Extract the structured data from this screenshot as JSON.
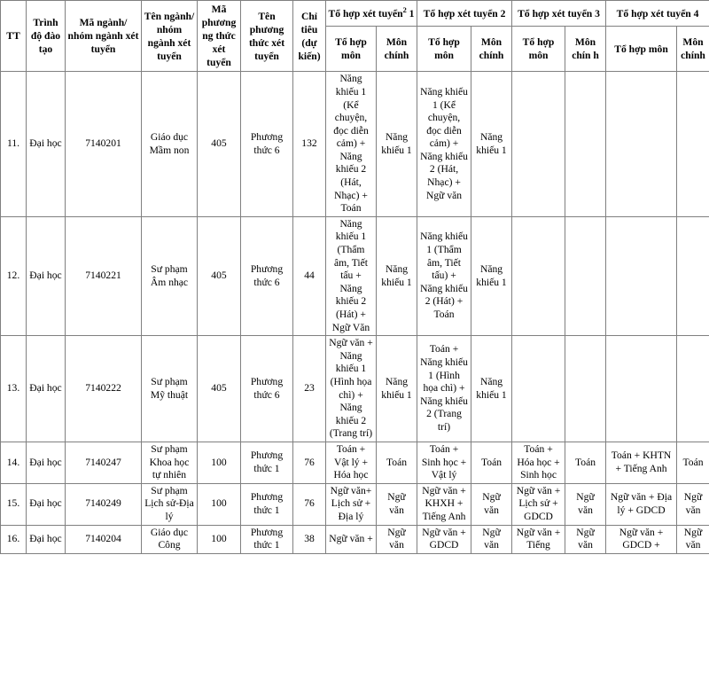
{
  "table": {
    "header": {
      "row1": [
        {
          "label": "TT",
          "rowspan": 2,
          "colspan": 1
        },
        {
          "label": "Trình độ đào tạo",
          "rowspan": 2,
          "colspan": 1
        },
        {
          "label": "Mã ngành/ nhóm ngành xét tuyển",
          "rowspan": 2,
          "colspan": 1
        },
        {
          "label": "Tên ngành/ nhóm ngành xét tuyển",
          "rowspan": 2,
          "colspan": 1
        },
        {
          "label": "Mã phương ng thức xét tuyển",
          "rowspan": 2,
          "colspan": 1
        },
        {
          "label": "Tên phương thức xét tuyển",
          "rowspan": 2,
          "colspan": 1
        },
        {
          "label": "Chỉ tiêu (dự kiến)",
          "rowspan": 2,
          "colspan": 1
        },
        {
          "label": "Tổ hợp xét tuyển",
          "footnote": "2",
          "suffix": " 1",
          "rowspan": 1,
          "colspan": 2
        },
        {
          "label": "Tổ hợp xét tuyển 2",
          "rowspan": 1,
          "colspan": 2
        },
        {
          "label": "Tổ hợp xét tuyển 3",
          "rowspan": 1,
          "colspan": 2
        },
        {
          "label": "Tổ hợp xét tuyển 4",
          "rowspan": 1,
          "colspan": 2
        }
      ],
      "row2": [
        "Tổ hợp môn",
        "Môn chính",
        "Tổ hợp môn",
        "Môn chính",
        "Tổ hợp môn",
        "Môn chín h",
        "Tổ hợp môn",
        "Môn chính"
      ]
    },
    "rows": [
      {
        "tt": "11.",
        "trinh_do": "Đại học",
        "ma_nganh": "7140201",
        "ten_nganh": "Giáo dục Mầm non",
        "ma_phuong_thuc": "405",
        "ten_phuong_thuc": "Phương thức 6",
        "ten_phuong_thuc_align": "middle",
        "chi_tieu": "132",
        "to_hop_1": "Năng khiếu 1 (Kể chuyện, đọc diễn cảm) + Năng khiếu 2 (Hát, Nhạc) + Toán",
        "mon_chinh_1": "Năng khiếu 1",
        "to_hop_2": "Năng khiếu 1 (Kể chuyện, đọc diễn cảm) + Năng khiếu 2 (Hát, Nhạc) + Ngữ văn",
        "mon_chinh_2": "Năng khiếu 1",
        "to_hop_3": "",
        "mon_chinh_3": "",
        "to_hop_4": "",
        "mon_chinh_4": ""
      },
      {
        "tt": "12.",
        "trinh_do": "Đại học",
        "ma_nganh": "7140221",
        "ten_nganh": "Sư phạm Âm nhạc",
        "ma_phuong_thuc": "405",
        "ten_phuong_thuc": "Phương thức 6",
        "ten_phuong_thuc_align": "top",
        "chi_tieu": "44",
        "to_hop_1": "Năng khiếu 1 (Thẩm âm, Tiết tấu + Năng khiếu 2 (Hát) + Ngữ Văn",
        "mon_chinh_1": "Năng khiếu 1",
        "to_hop_2": "Năng khiếu 1 (Thẩm âm, Tiết tấu) + Năng khiếu 2 (Hát) + Toán",
        "mon_chinh_2": "Năng khiếu 1",
        "to_hop_3": "",
        "mon_chinh_3": "",
        "to_hop_4": "",
        "mon_chinh_4": ""
      },
      {
        "tt": "13.",
        "trinh_do": "Đại học",
        "ma_nganh": "7140222",
        "ten_nganh": "Sư phạm Mỹ thuật",
        "ma_phuong_thuc": "405",
        "ten_phuong_thuc": "Phương thức 6",
        "ten_phuong_thuc_align": "top",
        "chi_tieu": "23",
        "to_hop_1": "Ngữ văn + Năng khiếu 1 (Hình họa chì) + Năng khiếu 2 (Trang trí)",
        "mon_chinh_1": "Năng khiếu 1",
        "to_hop_2": "Toán + Năng khiếu 1 (Hình họa chì) + Năng khiếu 2 (Trang trí)",
        "mon_chinh_2": "Năng khiếu 1",
        "to_hop_3": "",
        "mon_chinh_3": "",
        "to_hop_4": "",
        "mon_chinh_4": ""
      },
      {
        "tt": "14.",
        "trinh_do": "Đại học",
        "ma_nganh": "7140247",
        "ten_nganh": "Sư phạm Khoa học tự nhiên",
        "ma_phuong_thuc": "100",
        "ten_phuong_thuc": "Phương thức 1",
        "ten_phuong_thuc_align": "middle",
        "chi_tieu": "76",
        "to_hop_1": "Toán + Vật lý + Hóa học",
        "mon_chinh_1": "Toán",
        "to_hop_2": "Toán + Sinh học + Vật lý",
        "mon_chinh_2": "Toán",
        "to_hop_3": "Toán + Hóa học + Sinh học",
        "mon_chinh_3": "Toán",
        "to_hop_4": "Toán + KHTN + Tiếng Anh",
        "mon_chinh_4": "Toán"
      },
      {
        "tt": "15.",
        "trinh_do": "Đại học",
        "ma_nganh": "7140249",
        "ten_nganh": "Sư phạm Lịch sử-Địa lý",
        "ma_phuong_thuc": "100",
        "ten_phuong_thuc": "Phương thức 1",
        "ten_phuong_thuc_align": "top",
        "chi_tieu": "76",
        "to_hop_1": "Ngữ văn+ Lịch sử + Địa lý",
        "mon_chinh_1": "Ngữ văn",
        "to_hop_2": "Ngữ văn + KHXH + Tiếng Anh",
        "mon_chinh_2": "Ngữ văn",
        "to_hop_3": "Ngữ văn + Lịch sử + GDCD",
        "mon_chinh_3": "Ngữ văn",
        "to_hop_4": "Ngữ văn + Địa lý + GDCD",
        "mon_chinh_4": "Ngữ văn"
      },
      {
        "tt": "16.",
        "trinh_do": "Đại học",
        "ma_nganh": "7140204",
        "ten_nganh": "Giáo dục Công",
        "ma_phuong_thuc": "100",
        "ten_phuong_thuc": "Phương thức 1",
        "ten_phuong_thuc_align": "middle",
        "chi_tieu": "38",
        "to_hop_1": "Ngữ văn +",
        "mon_chinh_1": "Ngữ văn",
        "to_hop_2": "Ngữ văn + GDCD",
        "mon_chinh_2": "Ngữ văn",
        "to_hop_3": "Ngữ văn + Tiếng",
        "mon_chinh_3": "Ngữ văn",
        "to_hop_4": "Ngữ văn + GDCD +",
        "mon_chinh_4": "Ngữ văn"
      }
    ]
  }
}
